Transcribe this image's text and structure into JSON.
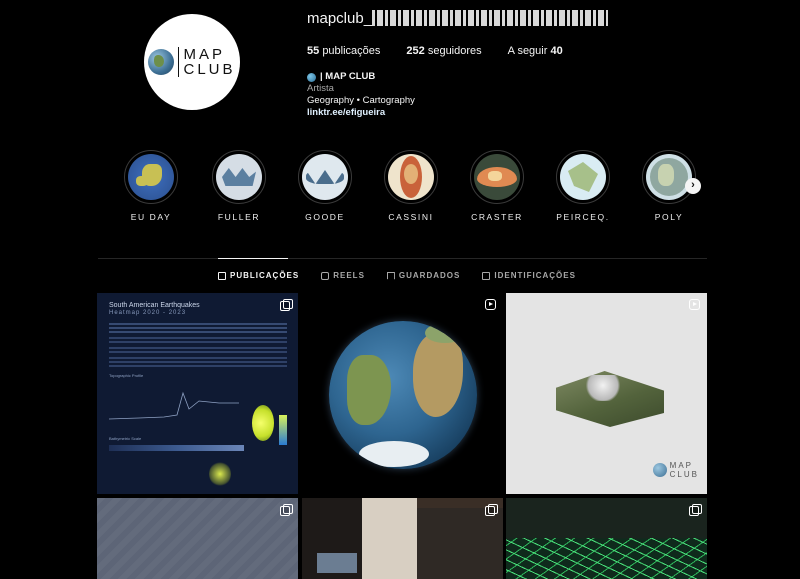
{
  "profile": {
    "username": "mapclub_",
    "posts_count": "55",
    "posts_label": "publicações",
    "followers_count": "252",
    "followers_label": "seguidores",
    "following_label": "A seguir",
    "following_count": "40",
    "display_name": "| MAP CLUB",
    "category": "Artista",
    "bio_line": "Geography • Cartography",
    "link": "linktr.ee/efigueira",
    "logo_line1": "MAP",
    "logo_line2": "CLUB"
  },
  "highlights": [
    {
      "label": "EU DAY",
      "icon": "eu-map"
    },
    {
      "label": "FULLER",
      "icon": "fuller-projection"
    },
    {
      "label": "GOODE",
      "icon": "goode-projection"
    },
    {
      "label": "CASSINI",
      "icon": "cassini-projection"
    },
    {
      "label": "CRASTER",
      "icon": "craster-projection"
    },
    {
      "label": "PEIRCEQ.",
      "icon": "peirce-quincuncial-projection"
    },
    {
      "label": "POLY",
      "icon": "polyconic-projection"
    }
  ],
  "tabs": [
    {
      "label": "PUBLICAÇÕES",
      "icon": "grid-icon",
      "active": true
    },
    {
      "label": "REELS",
      "icon": "reels-icon",
      "active": false
    },
    {
      "label": "GUARDADOS",
      "icon": "bookmark-icon",
      "active": false
    },
    {
      "label": "IDENTIFICAÇÕES",
      "icon": "tag-icon",
      "active": false
    }
  ],
  "posts": [
    {
      "type": "carousel",
      "title": "South American Earthquakes",
      "subtitle": "Heatmap 2020 - 2023",
      "label_topo": "Topographic Profile",
      "label_bathy": "Bathymetric Scale"
    },
    {
      "type": "reel",
      "subject": "earth-globe"
    },
    {
      "type": "reel",
      "subject": "3d-terrain-model"
    },
    {
      "type": "carousel",
      "subject": "grey-map"
    },
    {
      "type": "carousel",
      "subject": "room-photo"
    },
    {
      "type": "carousel",
      "subject": "green-city-map"
    }
  ],
  "colors": {
    "background": "#000000",
    "text": "#f5f5f5",
    "muted": "#a8a8a8",
    "link": "#e0f1ff"
  }
}
